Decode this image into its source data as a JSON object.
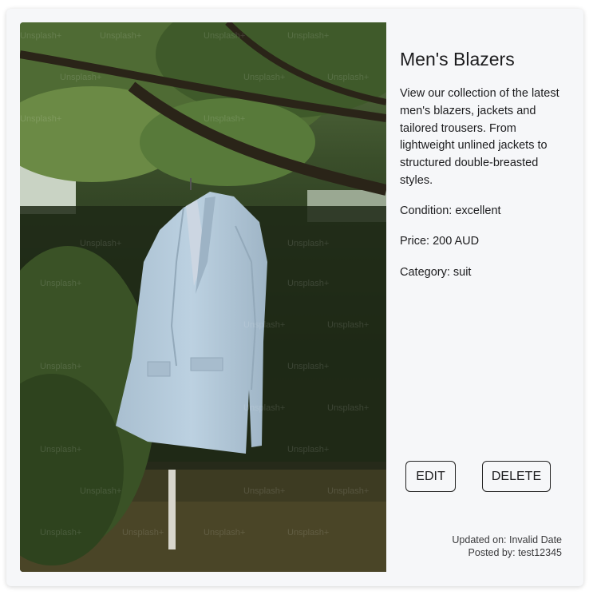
{
  "product": {
    "image_alt": "Light blue blazer hanging from a tree branch",
    "watermark_text": "Unsplash+",
    "title": "Men's Blazers",
    "description": "View our collection of the latest men's blazers, jackets and tailored trousers. From lightweight unlined jackets to structured double-breasted styles.",
    "condition": "Condition: excellent",
    "price": "Price: 200 AUD",
    "category": "Category: suit"
  },
  "actions": {
    "edit_label": "EDIT",
    "delete_label": "DELETE"
  },
  "meta": {
    "updated": "Updated on: Invalid Date",
    "posted": "Posted by: test12345"
  },
  "colors": {
    "card_bg": "#f6f7f9",
    "text": "#1c1c1e",
    "blazer": "#b5cbdc",
    "foliage": "#3f5a2a"
  }
}
